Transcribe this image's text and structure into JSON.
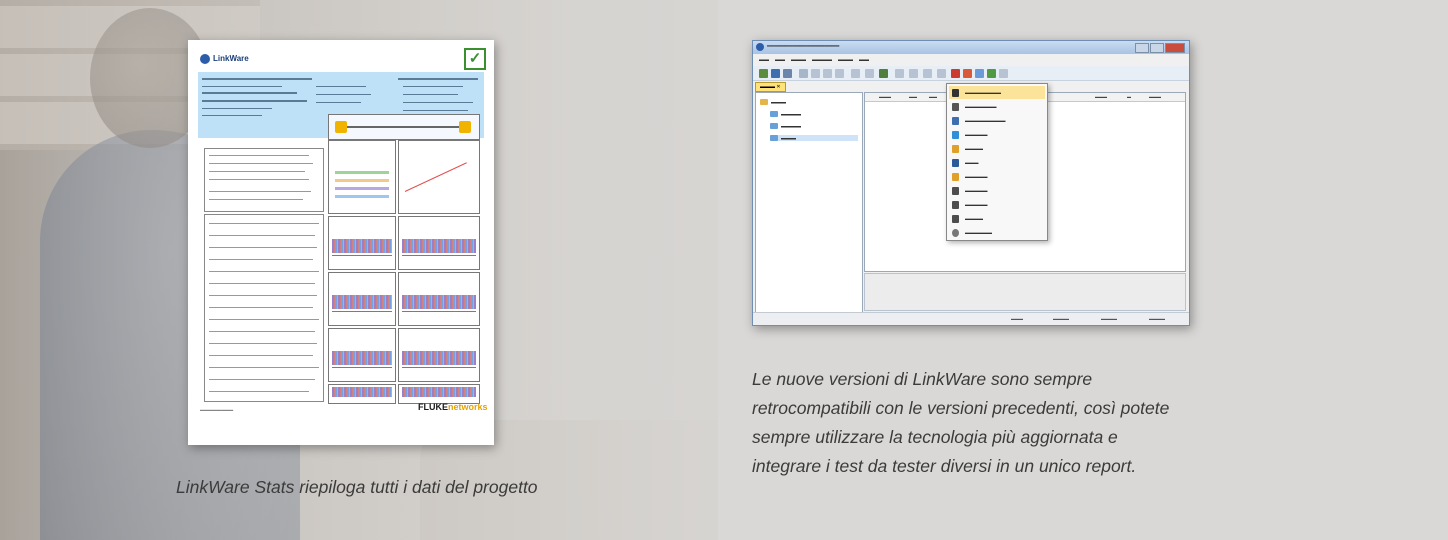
{
  "captions": {
    "left": "LinkWare Stats riepiloga tutti i dati del progetto",
    "right_lines": [
      "Le nuove versioni di LinkWare sono sempre",
      "retrocompatibili con le versioni precedenti, così potete",
      "sempre utilizzare la tecnologia più aggiornata e",
      "integrare i test da tester diversi in un unico report."
    ]
  },
  "icons": {
    "pass_check": "check-icon",
    "report_logo": "linkware-logo-icon",
    "app_icon": "linkware-app-icon"
  },
  "colors": {
    "report_header": "#bfe1f7",
    "pass_green": "#3a8f2e",
    "menu_highlight": "#fbe39a",
    "fluke_yellow": "#e5a400"
  }
}
